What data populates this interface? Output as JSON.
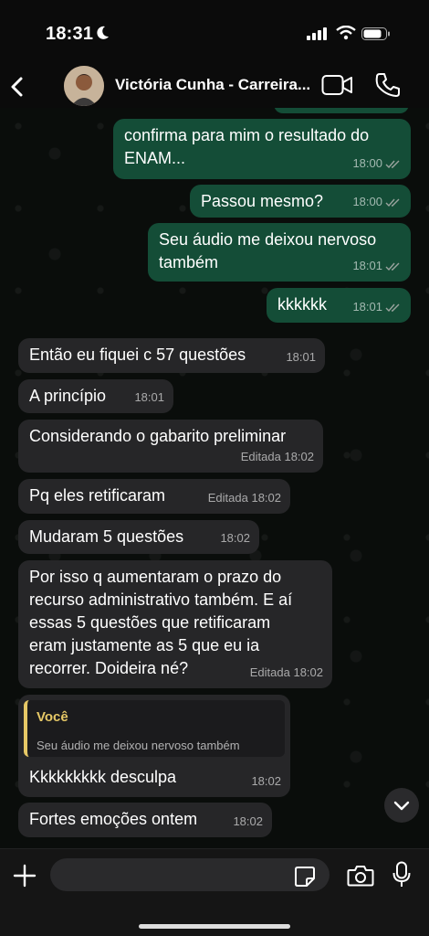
{
  "status_bar": {
    "time": "18:31"
  },
  "header": {
    "contact_name": "Victória Cunha - Carreira..."
  },
  "messages": [
    {
      "text": "confirma para mim o resultado do\nENAM...",
      "time": "18:00"
    },
    {
      "text": "Passou mesmo?",
      "time": "18:00"
    },
    {
      "text": "Seu áudio me deixou nervoso\ntambém",
      "time": "18:01"
    },
    {
      "text": "kkkkkk",
      "time": "18:01"
    },
    {
      "text": "Então eu fiquei c 57 questões",
      "time": "18:01"
    },
    {
      "text": "A princípio",
      "time": "18:01"
    },
    {
      "text": "Considerando o gabarito preliminar",
      "time": "Editada 18:02"
    },
    {
      "text": "Pq eles retificaram",
      "time": "Editada 18:02"
    },
    {
      "text": "Mudaram 5 questões",
      "time": "18:02"
    },
    {
      "text": "Por isso q aumentaram o prazo do\nrecurso administrativo também. E aí\nessas 5 questões que retificaram\neram justamente as 5 que eu ia\nrecorrer. Doideira né?",
      "time": "Editada 18:02"
    },
    {
      "text": "Kkkkkkkkk desculpa",
      "time": "18:02",
      "reply_name": "Você",
      "reply_text": "Seu áudio me deixou nervoso também"
    },
    {
      "text": "Fortes emoções ontem",
      "time": "18:02"
    }
  ],
  "composer": {
    "placeholder": ""
  },
  "colors": {
    "outgoing_bubble": "#144d37",
    "incoming_bubble": "#262628",
    "reply_accent": "#e6c866",
    "read_ticks": "#9aa39e"
  },
  "icons": [
    "back-chevron-icon",
    "video-call-icon",
    "phone-icon",
    "read-ticks-icon",
    "chevron-down-icon",
    "plus-icon",
    "sticker-icon",
    "camera-icon",
    "microphone-icon"
  ]
}
